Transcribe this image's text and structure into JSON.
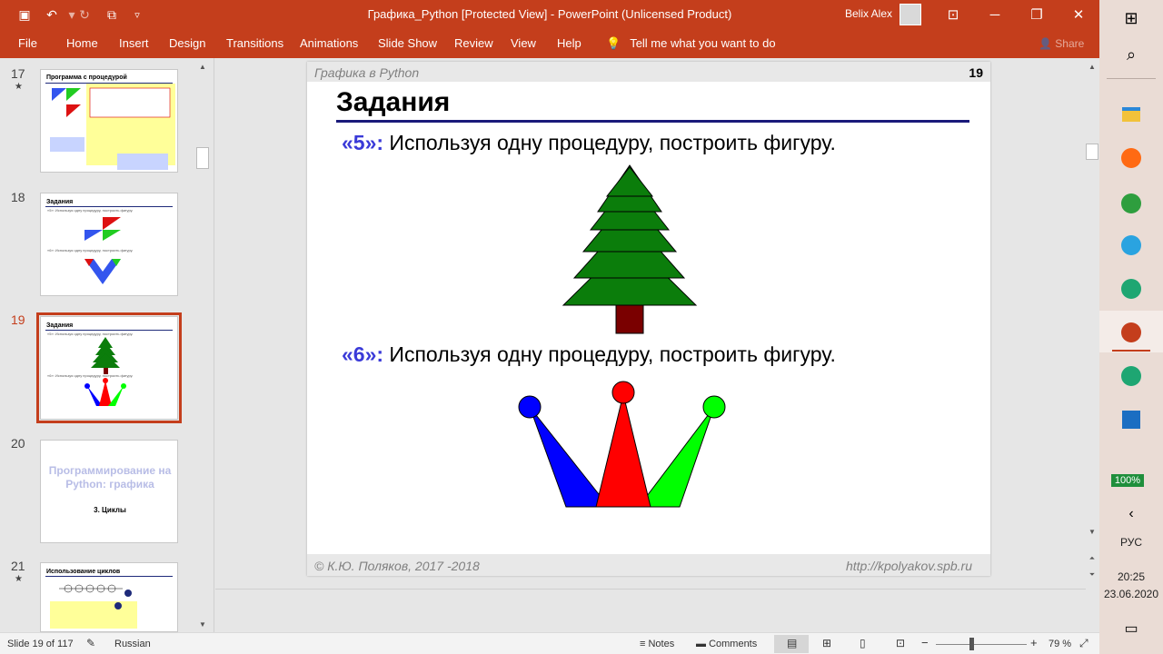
{
  "window": {
    "title": "Графика_Python [Protected View]  -  PowerPoint (Unlicensed Product)",
    "user": "Belix Alex"
  },
  "ribbon": {
    "tabs": [
      "File",
      "Home",
      "Insert",
      "Design",
      "Transitions",
      "Animations",
      "Slide Show",
      "Review",
      "View",
      "Help"
    ],
    "tell_me": "Tell me what you want to do",
    "share": "Share"
  },
  "thumbnails": [
    {
      "num": "17",
      "title": "Программа с процедурой"
    },
    {
      "num": "18",
      "title": "Задания",
      "t5": "«5»: Используя одну процедуру, построить фигуру.",
      "t6": "«6»: Используя одну процедуру, построить фигуру."
    },
    {
      "num": "19",
      "title": "Задания",
      "t5": "«5»: Используя одну процедуру, построить фигуру.",
      "t6": "«6»: Используя одну процедуру, построить фигуру."
    },
    {
      "num": "20",
      "title": "Программирование на Python: графика",
      "subtitle": "3. Циклы"
    },
    {
      "num": "21",
      "title": "Использование циклов"
    }
  ],
  "slide": {
    "course": "Графика в Python",
    "page": "19",
    "heading": "Задания",
    "task5_label": "«5»:",
    "task5_text": " Используя одну процедуру, построить фигуру.",
    "task6_label": "«6»:",
    "task6_text": " Используя одну процедуру, построить фигуру.",
    "footer_left": "© К.Ю. Поляков, 2017 -2018",
    "footer_right": "http://kpolyakov.spb.ru"
  },
  "status": {
    "slide_info": "Slide 19 of 117",
    "language": "Russian",
    "notes": "Notes",
    "comments": "Comments",
    "zoom": "79 %"
  },
  "taskbar": {
    "battery": "100%",
    "lang": "РУС",
    "time": "20:25",
    "date": "23.06.2020"
  },
  "colors": {
    "accent": "#c43e1c",
    "tree_green": "#0b7d0b",
    "trunk": "#7a0000",
    "blue": "#0000ff",
    "red": "#ff0000",
    "green": "#00ff00"
  }
}
